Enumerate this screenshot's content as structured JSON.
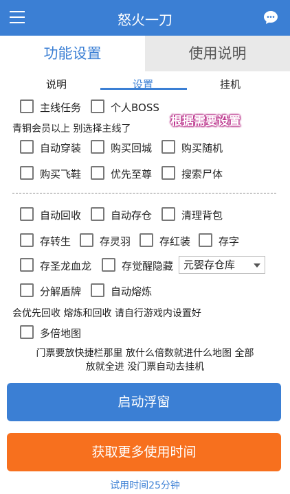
{
  "topbar": {
    "title": "怒火一刀",
    "menu_icon": "hamburger-menu-icon",
    "chat_icon": "chat-bubble-icon",
    "color": "#3b7fd4"
  },
  "main_tabs": [
    {
      "label": "功能设置",
      "active": true
    },
    {
      "label": "使用说明",
      "active": false
    }
  ],
  "sub_tabs": [
    {
      "label": "说明",
      "active": false
    },
    {
      "label": "设置",
      "active": true
    },
    {
      "label": "挂机",
      "active": false
    }
  ],
  "options": {
    "main_quest": "主线任务",
    "personal_boss": "个人BOSS",
    "bronze_note": "青铜会员以上 别选择主线了",
    "badge": "根据需要设置",
    "auto_equip": "自动穿装",
    "buy_return": "购买回城",
    "buy_random": "购买随机",
    "buy_boots": "购买飞鞋",
    "prefer_supreme": "优先至尊",
    "search_corpse": "搜索尸体",
    "auto_recycle": "自动回收",
    "auto_store": "自动存仓",
    "clean_bag": "清理背包",
    "store_rebirth": "存转生",
    "store_spirit_feather": "存灵羽",
    "store_red_gear": "存红装",
    "store_char": "存字",
    "store_dragon_blood": "存圣龙血龙",
    "store_awaken_hidden": "存觉醒隐藏",
    "warehouse_select": "元婴存仓库",
    "split_shield": "分解盾牌",
    "auto_smelt": "自动熔炼",
    "recycle_note": "会优先回收 熔炼和回收 请自行游戏内设置好",
    "multi_map": "多倍地图",
    "ticket_note_1": "门票要放快捷栏那里  放什么倍数就进什么地图  全部",
    "ticket_note_2": "放就全进  没门票自动去挂机"
  },
  "buttons": {
    "start_float": "启动浮窗",
    "get_more_time": "获取更多使用时间"
  },
  "trial_text": "试用时间25分钟",
  "colors": {
    "accent": "#3b7fd4",
    "orange": "#f7701e",
    "badge": "#c0278a"
  }
}
